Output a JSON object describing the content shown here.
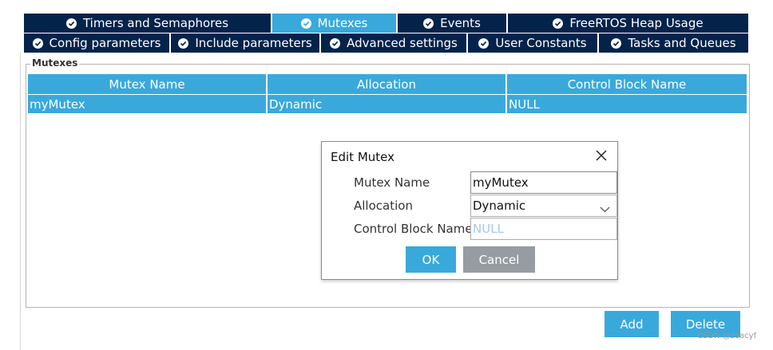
{
  "tabs_row1": [
    "Timers and Semaphores",
    "Mutexes",
    "Events",
    "FreeRTOS Heap Usage"
  ],
  "tabs_row2": [
    "Config parameters",
    "Include parameters",
    "Advanced settings",
    "User Constants",
    "Tasks and Queues"
  ],
  "active_tab": "Mutexes",
  "group_title": "Mutexes",
  "table": {
    "columns": [
      "Mutex Name",
      "Allocation",
      "Control Block Name"
    ],
    "rows": [
      [
        "myMutex",
        "Dynamic",
        "NULL"
      ]
    ]
  },
  "dialog": {
    "title": "Edit Mutex",
    "fields": {
      "mutex_name": {
        "label": "Mutex Name",
        "value": "myMutex"
      },
      "allocation": {
        "label": "Allocation",
        "value": "Dynamic"
      },
      "control_block": {
        "label": "Control Block Name",
        "placeholder": "NULL"
      }
    },
    "ok_label": "OK",
    "cancel_label": "Cancel"
  },
  "buttons": {
    "add_label": "Add",
    "delete_label": "Delete"
  },
  "watermark": "CSDN @zoacyf",
  "colors": {
    "tab_dark": "#03234b",
    "accent": "#39a9dc",
    "cancel_gray": "#969ca2"
  }
}
